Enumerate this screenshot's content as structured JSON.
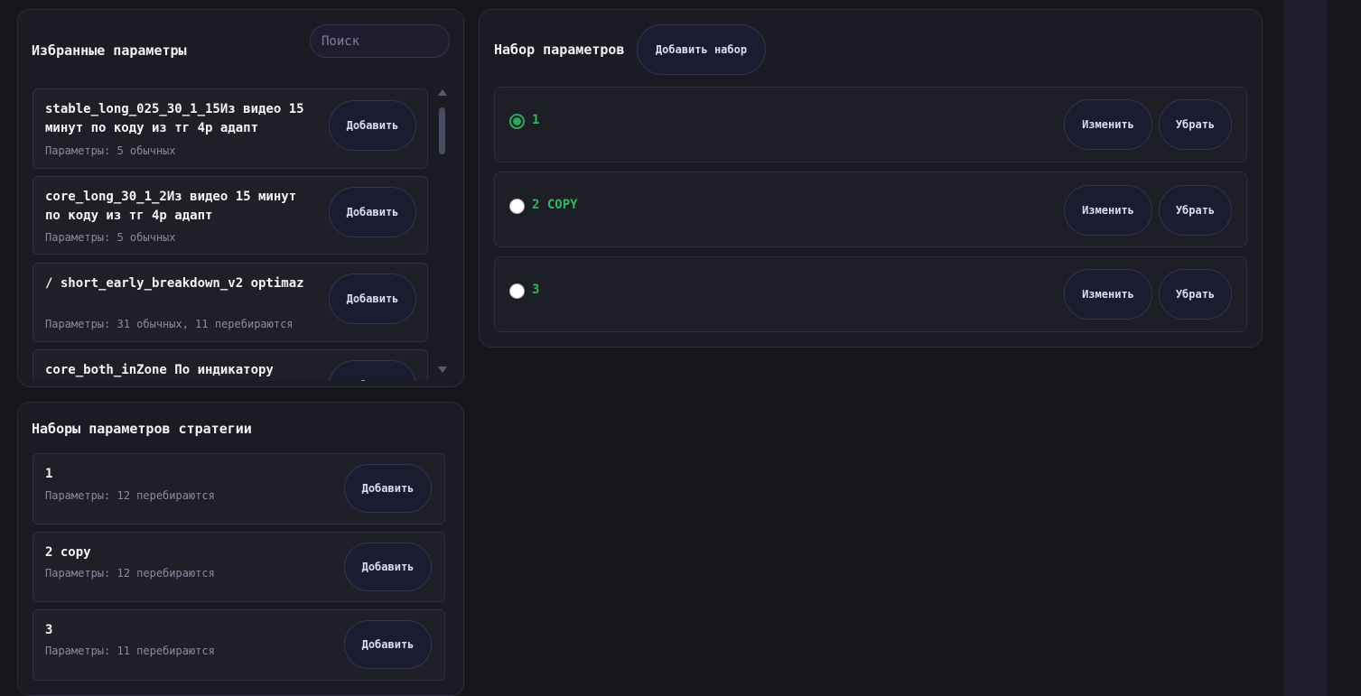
{
  "favorites": {
    "title": "Избранные параметры",
    "search_placeholder": "Поиск",
    "items": [
      {
        "title": "stable_long_025_30_1_15Из видео 15 минут по коду из тг 4р адапт",
        "sub": "Параметры: 5 обычных",
        "button": "Добавить"
      },
      {
        "title": "core_long_30_1_2Из видео 15 минут по коду из тг 4р адапт",
        "sub": "Параметры: 5 обычных",
        "button": "Добавить"
      },
      {
        "title": "/ short_early_breakdown_v2 optimaz",
        "sub": "Параметры: 31 обычных, 11 перебираются",
        "button": "Добавить"
      },
      {
        "title": "core_both_inZone По индикатору",
        "sub": "",
        "button": "Добавить"
      }
    ]
  },
  "strategy_sets": {
    "title": "Наборы параметров стратегии",
    "items": [
      {
        "title": "1",
        "sub": "Параметры: 12 перебираются",
        "button": "Добавить"
      },
      {
        "title": "2 copy",
        "sub": "Параметры: 12 перебираются",
        "button": "Добавить"
      },
      {
        "title": "3",
        "sub": "Параметры: 11 перебираются",
        "button": "Добавить"
      }
    ]
  },
  "param_set": {
    "title": "Набор параметров",
    "add_button": "Добавить набор",
    "rows": [
      {
        "label": "1",
        "checked": true,
        "edit": "Изменить",
        "remove": "Убрать"
      },
      {
        "label": "2 COPY",
        "checked": false,
        "edit": "Изменить",
        "remove": "Убрать"
      },
      {
        "label": "3",
        "checked": false,
        "edit": "Изменить",
        "remove": "Убрать"
      }
    ]
  },
  "colors": {
    "accent_green": "#34b55e",
    "background": "#16161d"
  }
}
